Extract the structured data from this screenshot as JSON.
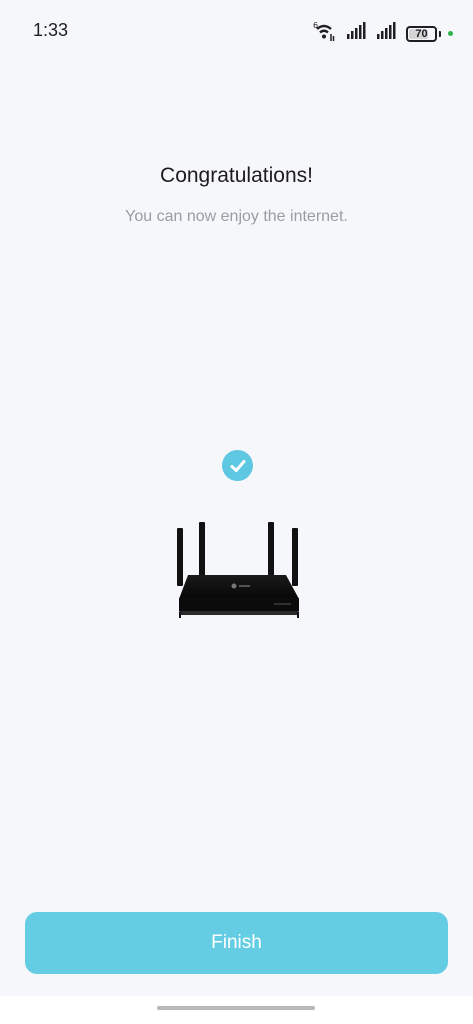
{
  "status_bar": {
    "time": "1:33",
    "battery_level": "70",
    "battery_percent": 70,
    "wifi_badge": "6",
    "colors": {
      "text": "#1f1f1f",
      "dot": "#2bb34a"
    }
  },
  "main": {
    "title": "Congratulations!",
    "subtitle": "You can now enjoy the internet."
  },
  "illustration": {
    "status_icon": "check-circle-icon",
    "device_icon": "router-icon"
  },
  "actions": {
    "finish_label": "Finish"
  },
  "colors": {
    "background": "#f6f7fb",
    "accent": "#64cde3",
    "check": "#5ec7e1",
    "title": "#1d1d1f",
    "subtitle": "#9a9ca3"
  }
}
